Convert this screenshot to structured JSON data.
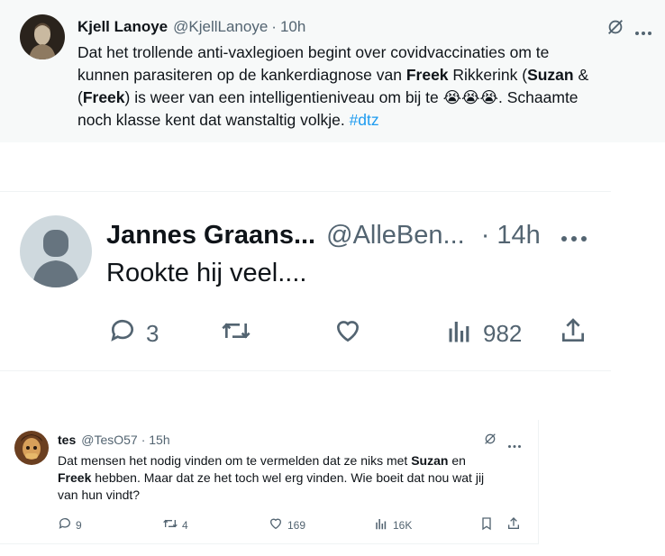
{
  "tweet1": {
    "display_name": "Kjell Lanoye",
    "handle": "@KjellLanoye",
    "time": "10h",
    "text_a": "Dat het trollende anti-vaxlegioen begint over covidvaccinaties om te",
    "text_b": "kunnen parasiteren op de kankerdiagnose van ",
    "bold_freek": "Freek",
    "text_c": " Rikkerink (",
    "bold_suzan": "Suzan",
    "text_d": " &",
    "bold_freek2": "Freek",
    "text_e": ") is weer van een intelligentieniveau om bij te ",
    "emoji": "😭😭😭",
    "text_f": ". Schaamte",
    "text_g": "noch klasse kent dat wanstaltig volkje. ",
    "hashtag": "#dtz"
  },
  "tweet2": {
    "display_name": "Jannes Graans...",
    "handle": "@AlleBen...",
    "time": "· 14h",
    "text": "Rookte hij veel....",
    "replies": "3",
    "reposts": "",
    "likes": "",
    "views": "982"
  },
  "tweet3": {
    "display_name": "tes",
    "handle": "@TesO57",
    "time": "· 15h",
    "text_a": "Dat mensen het nodig vinden om te vermelden dat ze niks met ",
    "bold_suzan": "Suzan",
    "text_b": " en",
    "bold_freek": "Freek",
    "text_c": " hebben. Maar dat ze het toch wel erg vinden. Wie boeit dat nou wat jij",
    "text_d": "van hun vindt?",
    "replies": "9",
    "reposts": "4",
    "likes": "169",
    "views": "16K"
  },
  "icons": {
    "more": "more-icon",
    "grok": "grok-icon",
    "reply": "reply-icon",
    "repost": "repost-icon",
    "like": "like-icon",
    "views": "views-icon",
    "share": "share-icon",
    "bookmark": "bookmark-icon"
  }
}
